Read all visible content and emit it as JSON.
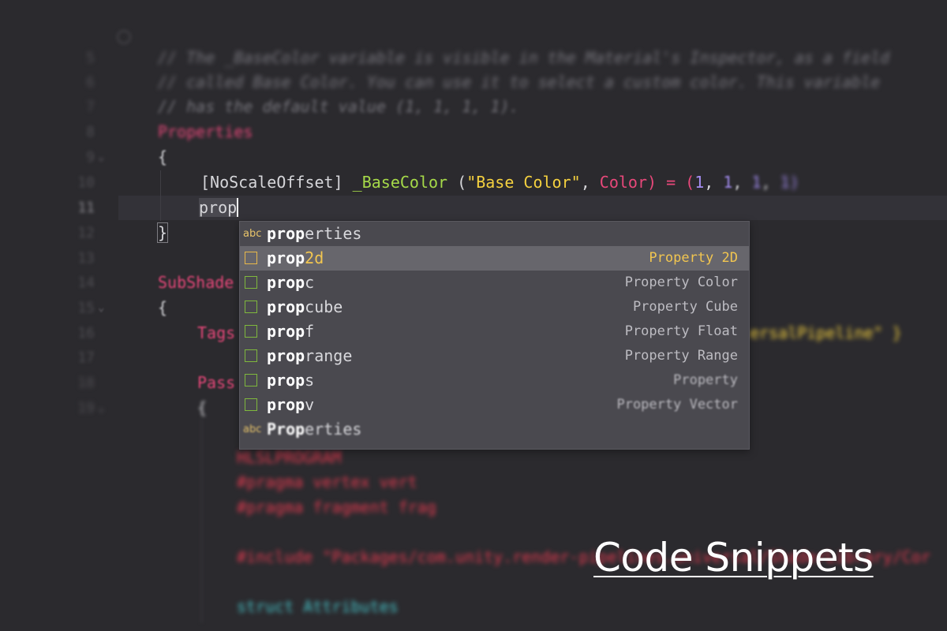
{
  "editor": {
    "line_numbers": [
      "5",
      "6",
      "7",
      "8",
      "9",
      "10",
      "11",
      "12",
      "13",
      "14",
      "15",
      "16",
      "17",
      "18",
      "19"
    ],
    "comment_lines": [
      "// The _BaseColor variable is visible in the Material's Inspector, as a field",
      "// called Base Color. You can use it to select a custom color. This variable",
      "// has the default value (1, 1, 1, 1)."
    ],
    "properties_keyword": "Properties",
    "open_brace": "{",
    "close_brace": "}",
    "property_line": {
      "attribute": "[NoScaleOffset]",
      "name": "_BaseColor",
      "open_paren": " (",
      "display_name": "\"Base Color\"",
      "comma": ", ",
      "type": "Color",
      "close_eq": ") = (",
      "v1": "1",
      "sep1": ", ",
      "v2": "1",
      "sep2": ", ",
      "v3": "1",
      "sep3": ", ",
      "v4": "1)"
    },
    "typed_text": "prop",
    "subshader_keyword": "SubShade",
    "tags_keyword": "Tags",
    "tags_tail": "ersalPipeline\" }",
    "pass_keyword": "Pass",
    "blurred_lines": [
      "HLSLPROGRAM",
      "#pragma vertex vert",
      "#pragma fragment frag",
      "#include \"Packages/com.unity.render-pipelines.universal/ShaderLibrary/Core.hlsl\"",
      "struct Attributes"
    ]
  },
  "autocomplete": {
    "items": [
      {
        "icon": "abc-text-icon",
        "match": "prop",
        "rest": "erties",
        "detail": "",
        "selected": false
      },
      {
        "icon": "snippet-icon",
        "match": "prop",
        "rest": "2d",
        "detail": "Property 2D",
        "selected": true
      },
      {
        "icon": "snippet-icon",
        "match": "prop",
        "rest": "c",
        "detail": "Property Color",
        "selected": false
      },
      {
        "icon": "snippet-icon",
        "match": "prop",
        "rest": "cube",
        "detail": "Property Cube",
        "selected": false
      },
      {
        "icon": "snippet-icon",
        "match": "prop",
        "rest": "f",
        "detail": "Property Float",
        "selected": false
      },
      {
        "icon": "snippet-icon",
        "match": "prop",
        "rest": "range",
        "detail": "Property Range",
        "selected": false
      },
      {
        "icon": "snippet-icon",
        "match": "prop",
        "rest": "s",
        "detail": "Property",
        "selected": false
      },
      {
        "icon": "snippet-icon",
        "match": "prop",
        "rest": "v",
        "detail": "Property Vector",
        "selected": false
      },
      {
        "icon": "abc-text-icon",
        "match": "Prop",
        "rest": "erties",
        "detail": "",
        "selected": false
      }
    ],
    "abc_label": "abc"
  },
  "caption": "Code Snippets",
  "colors": {
    "background": "#2b2a2e",
    "keyword": "#e8487a",
    "identifier": "#a6da49",
    "string": "#f5d13f",
    "number": "#a48df2",
    "selected_detail": "#f2c650"
  }
}
